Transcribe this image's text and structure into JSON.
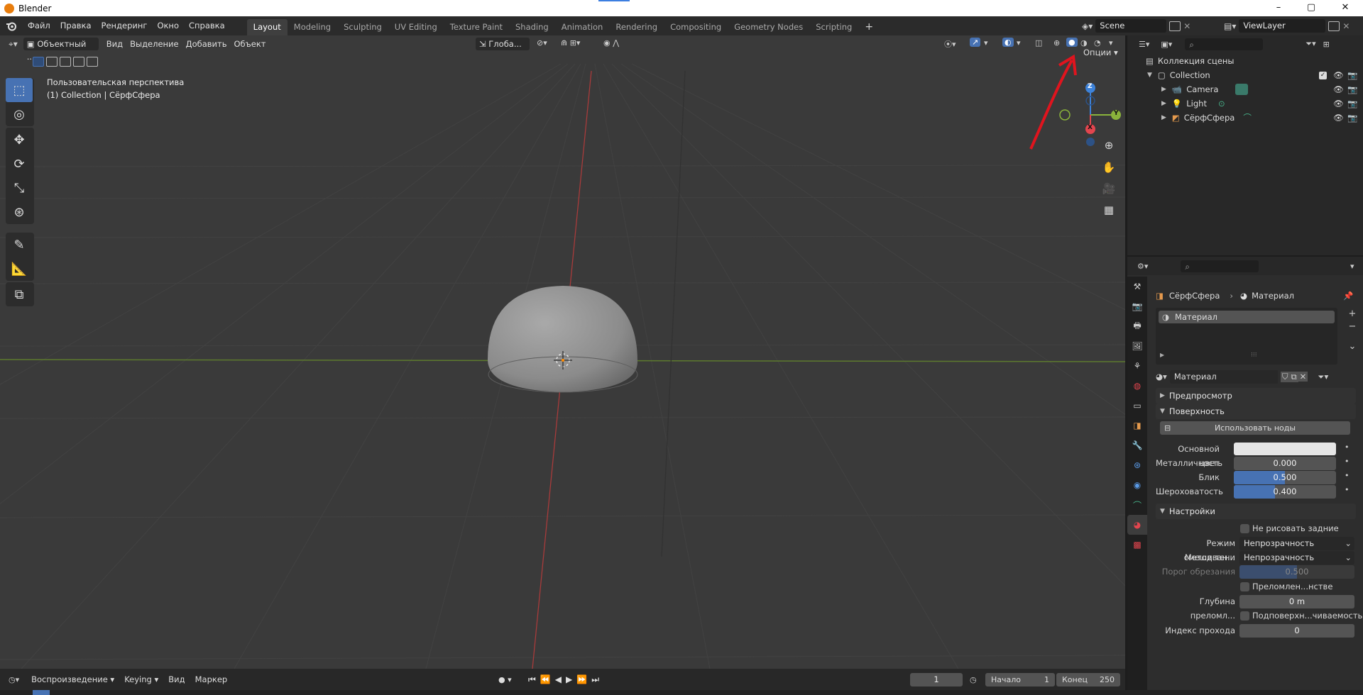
{
  "window": {
    "title": "Blender",
    "min": "–",
    "max": "▢",
    "close": "✕"
  },
  "menu": [
    "Файл",
    "Правка",
    "Рендеринг",
    "Окно",
    "Справка"
  ],
  "workspaces": [
    "Layout",
    "Modeling",
    "Sculpting",
    "UV Editing",
    "Texture Paint",
    "Shading",
    "Animation",
    "Rendering",
    "Compositing",
    "Geometry Nodes",
    "Scripting"
  ],
  "workspace_add": "+",
  "scene": {
    "name": "Scene",
    "view_layer": "ViewLayer"
  },
  "viewport_header": {
    "mode": "Объектный ...",
    "menus": [
      "Вид",
      "Выделение",
      "Добавить",
      "Объект"
    ],
    "orientation": "Глоба...",
    "options": "Опции"
  },
  "viewport_info": {
    "line1": "Пользовательская перспектива",
    "line2": "(1) Collection | СёрфСфера"
  },
  "gizmo": {
    "z": "Z",
    "y": "Y",
    "x": "X"
  },
  "outliner": {
    "root": "Коллекция сцены",
    "collection": "Collection",
    "items": [
      "Camera",
      "Light",
      "СёрфСфера"
    ]
  },
  "properties": {
    "breadcrumb_object": "СёрфСфера",
    "breadcrumb_material": "Материал",
    "slot_name": "Материал",
    "material_name": "Материал",
    "panel_preview": "Предпросмотр",
    "panel_surface": "Поверхность",
    "use_nodes": "Использовать ноды",
    "base_color_label": "Основной цвет",
    "base_color": "#e6e6e6",
    "metallic_label": "Металличность",
    "metallic": "0.000",
    "specular_label": "Блик",
    "specular": "0.500",
    "roughness_label": "Шероховатость",
    "roughness": "0.400",
    "panel_settings": "Настройки",
    "backface_label": "Не рисовать задние гра...",
    "blend_mode_label": "Режим смешиван...",
    "blend_mode": "Непрозрачность",
    "shadow_mode_label": "Метод тени",
    "shadow_mode": "Непрозрачность",
    "clip_threshold_label": "Порог обрезания",
    "clip_threshold": "0.500",
    "screen_refraction_label": "Преломлен...нстве экрана",
    "refraction_depth_label": "Глубина преломл...",
    "refraction_depth": "0 m",
    "sss_translucency_label": "Подповерхн...чиваемость",
    "pass_index_label": "Индекс прохода",
    "pass_index": "0"
  },
  "timeline": {
    "playback": "Воспроизведение",
    "keying": "Keying",
    "view": "Вид",
    "marker": "Маркер",
    "current_frame": "1",
    "start_label": "Начало",
    "start": "1",
    "end_label": "Конец",
    "end": "250"
  },
  "colors": {
    "accent": "#4772b3",
    "annotation_arrow": "#e0141e",
    "x_axis": "#e2454e",
    "y_axis": "#8ab33b",
    "z_axis": "#3d82d9"
  }
}
